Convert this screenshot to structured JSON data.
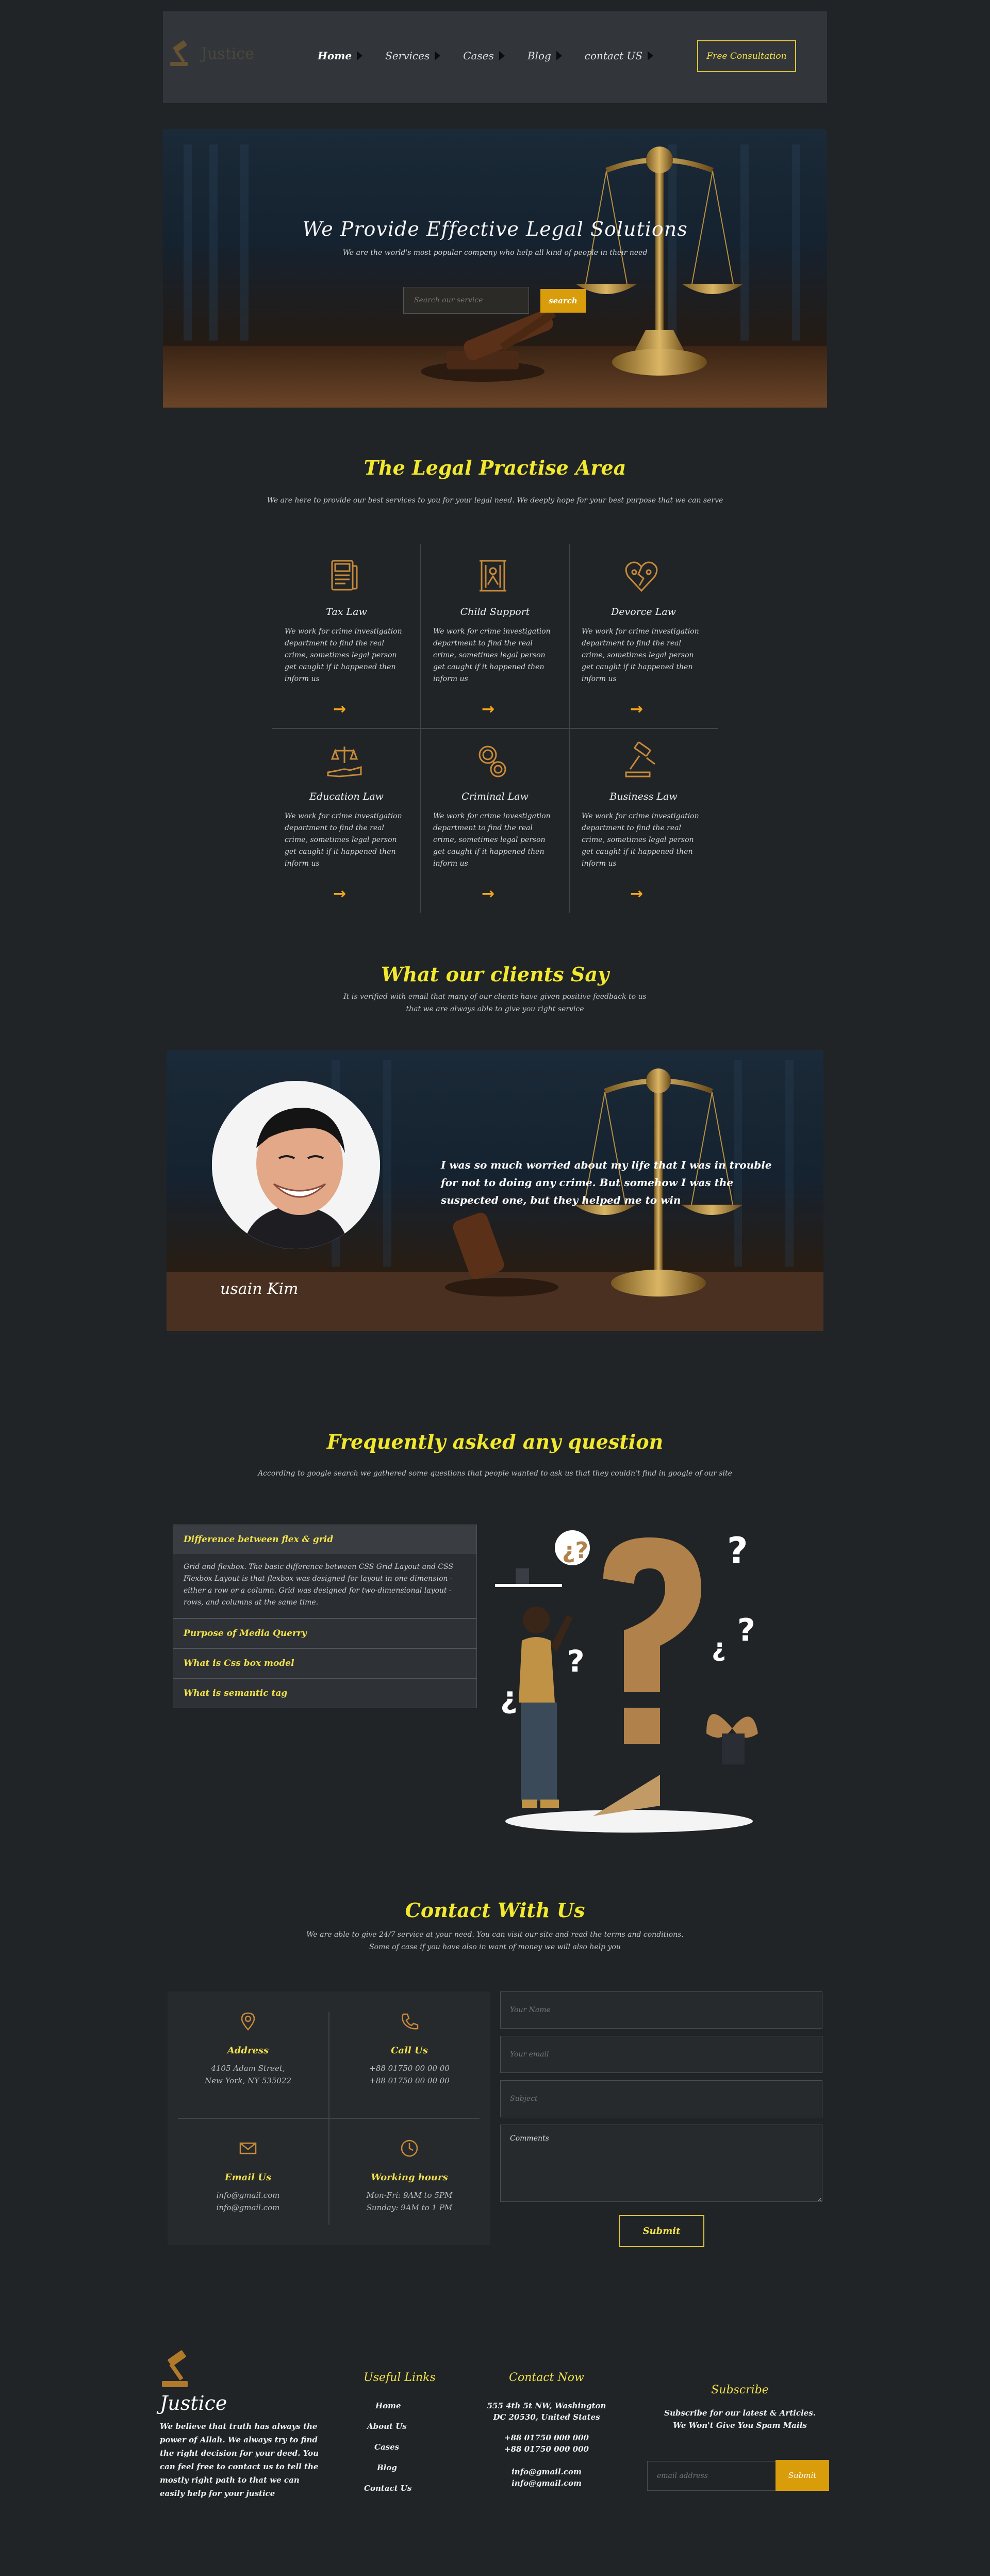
{
  "nav": {
    "logo_text": "Justice",
    "links": [
      {
        "label": "Home"
      },
      {
        "label": "Services"
      },
      {
        "label": "Cases"
      },
      {
        "label": "Blog"
      },
      {
        "label": "contact US"
      }
    ],
    "cta_label": "Free Consultation"
  },
  "hero": {
    "title": "We Provide Effective Legal Solutions",
    "subtitle": "We are the world's most popular company who help all kind of people in their need",
    "search_placeholder": "Search our service",
    "search_button": "search"
  },
  "practice": {
    "title": "The Legal Practise Area",
    "subtitle": "We are here to provide our best services to you for your legal need. We deeply hope for your best purpose that we can serve",
    "items": [
      {
        "title": "Tax Law",
        "icon": "tax-document-icon",
        "desc": "We work for crime investigation department to find the real crime, sometimes legal person get caught if it happened then inform us"
      },
      {
        "title": "Child Support",
        "icon": "child-support-icon",
        "desc": "We work for crime investigation department to find the real crime, sometimes legal person get caught if it happened then inform us"
      },
      {
        "title": "Devorce Law",
        "icon": "broken-heart-icon",
        "desc": "We work for crime investigation department to find the real crime, sometimes legal person get caught if it happened then inform us"
      },
      {
        "title": "Education Law",
        "icon": "hand-scale-icon",
        "desc": "We work for crime investigation department to find the real crime, sometimes legal person get caught if it happened then inform us"
      },
      {
        "title": "Criminal Law",
        "icon": "handcuffs-icon",
        "desc": "We work for crime investigation department to find the real crime, sometimes legal person get caught if it happened then inform us"
      },
      {
        "title": "Business Law",
        "icon": "gavel-icon",
        "desc": "We work for crime investigation department to find the real crime, sometimes legal person get caught if it happened then inform us"
      }
    ],
    "arrow": "→"
  },
  "clients": {
    "title": "What our clients Say",
    "subtitle_1": "It is verified with email that many of our clients have given positive feedback to us",
    "subtitle_2": "that we are always able to give you right service",
    "quote": "I was so much worried about my life that I was in trouble for not to doing any crime. But somehow I was the suspected one, but they helped me to win",
    "name": "usain Kim"
  },
  "faq": {
    "title": "Frequently asked any question",
    "subtitle": "According to google search we gathered some questions that people wanted to ask us that they couldn't find in google of our site",
    "items": [
      {
        "q": "Difference between flex & grid",
        "a": "Grid and flexbox. The basic difference between CSS Grid Layout and CSS Flexbox Layout is that flexbox was designed for layout in one dimension - either a row or a column. Grid was designed for two-dimensional layout - rows, and columns at the same time."
      },
      {
        "q": "Purpose of Media Querry"
      },
      {
        "q": "What is Css box model"
      },
      {
        "q": "What is semantic tag"
      }
    ]
  },
  "contact": {
    "title": "Contact With Us",
    "subtitle_1": "We are able to give 24/7 service at your need. You can visit our site and read the terms and conditions.",
    "subtitle_2": "Some of case if you have also in want of money we will also help you",
    "cards": [
      {
        "title": "Address",
        "icon": "location-pin-icon",
        "lines": [
          "4105 Adam Street,",
          "New York, NY 535022"
        ]
      },
      {
        "title": "Call Us",
        "icon": "phone-icon",
        "lines": [
          "+88 01750 00 00 00",
          "+88 01750 00 00 00"
        ]
      },
      {
        "title": "Email Us",
        "icon": "envelope-icon",
        "lines": [
          "info@gmail.com",
          "info@gmail.com"
        ]
      },
      {
        "title": "Working hours",
        "icon": "clock-icon",
        "lines": [
          "Mon-Fri: 9AM to 5PM",
          "Sunday: 9AM to 1 PM"
        ]
      }
    ],
    "form": {
      "name_placeholder": "Your Name",
      "email_placeholder": "Your email",
      "subject_placeholder": "Subject",
      "comments_value": "Comments",
      "submit": "Submit"
    }
  },
  "footer": {
    "brand": "Justice",
    "brand_desc": "We believe that truth has always the power of Allah. We always try to find the right decision for your deed. You can feel free to contact us to tell the mostly right path to that we can easily help for your justice",
    "links_title": "Useful Links",
    "links": [
      "Home",
      "About Us",
      "Cases",
      "Blog",
      "Contact Us"
    ],
    "contact_title": "Contact Now",
    "address_1": "555 4th 5t NW, Washington",
    "address_2": "DC 20530, United States",
    "phone_1": "+88 01750 000 000",
    "phone_2": "+88 01750 000 000",
    "email_1": "info@gmail.com",
    "email_2": "info@gmail.com",
    "subscribe_title": "Subscribe",
    "subscribe_text_1": "Subscribe for our latest & Articles.",
    "subscribe_text_2": "We Won't Give You Spam Mails",
    "subscribe_placeholder": "email address",
    "subscribe_button": "Submit"
  },
  "colors": {
    "background": "#202426",
    "accent_yellow": "#f2e82c",
    "button_gold": "#d99d0b",
    "arrow_orange": "#f0a51a",
    "icon_bronze": "#c88a3a"
  }
}
